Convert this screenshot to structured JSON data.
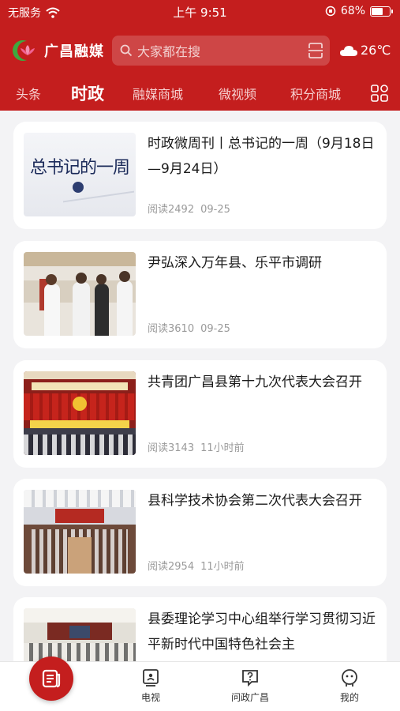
{
  "status_bar": {
    "carrier": "无服务",
    "time": "上午 9:51",
    "battery_percent": "68%",
    "battery_level": 0.68
  },
  "header": {
    "app_name": "广昌融媒",
    "search_placeholder": "大家都在搜",
    "temperature": "26℃",
    "weather_icon": "cloud-icon"
  },
  "tabs": [
    {
      "label": "头条",
      "active": false
    },
    {
      "label": "时政",
      "active": true
    },
    {
      "label": "融媒商城",
      "active": false
    },
    {
      "label": "微视频",
      "active": false
    },
    {
      "label": "积分商城",
      "active": false
    }
  ],
  "articles": [
    {
      "title": "时政微周刊丨总书记的一周（9月18日—9月24日）",
      "reads": "阅读2492",
      "time": "09-25",
      "thumb_text": "总书记的一周",
      "thumb_type": "text"
    },
    {
      "title": "尹弘深入万年县、乐平市调研",
      "reads": "阅读3610",
      "time": "09-25",
      "thumb_type": "people"
    },
    {
      "title": "共青团广昌县第十九次代表大会召开",
      "reads": "阅读3143",
      "time": "11小时前",
      "thumb_type": "stage"
    },
    {
      "title": "县科学技术协会第二次代表大会召开",
      "reads": "阅读2954",
      "time": "11小时前",
      "thumb_type": "hall"
    },
    {
      "title": "县委理论学习中心组举行学习贯彻习近平新时代中国特色社会主",
      "reads": "",
      "time": "",
      "thumb_type": "meeting"
    }
  ],
  "bottom_nav": [
    {
      "label": "",
      "icon": "home-news-icon"
    },
    {
      "label": "电视",
      "icon": "tv-icon"
    },
    {
      "label": "问政广昌",
      "icon": "question-icon"
    },
    {
      "label": "我的",
      "icon": "user-icon"
    }
  ],
  "colors": {
    "brand_red": "#c41e1e"
  }
}
